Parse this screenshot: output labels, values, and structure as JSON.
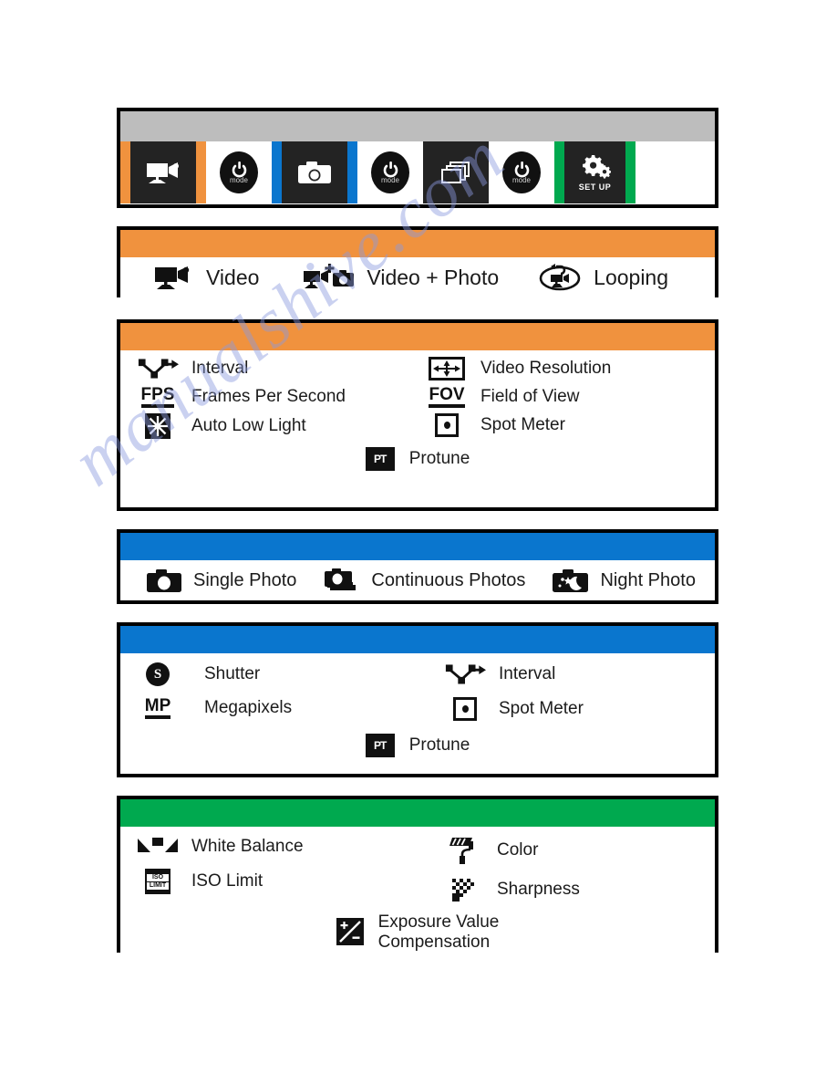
{
  "watermark": {
    "text": "manualshive.com"
  },
  "mode_strip": {
    "items": [
      {
        "name": "video-mode",
        "icon": "video-camera-icon",
        "accent": "#f0923e",
        "style": "dark"
      },
      {
        "name": "mode-button-1",
        "icon": "power-mode-icon",
        "label": "mode",
        "style": "light"
      },
      {
        "name": "photo-mode",
        "icon": "camera-icon",
        "accent": "#0a76ce",
        "style": "dark"
      },
      {
        "name": "mode-button-2",
        "icon": "power-mode-icon",
        "label": "mode",
        "style": "light"
      },
      {
        "name": "multishot-mode",
        "icon": "burst-stack-icon",
        "style": "dark"
      },
      {
        "name": "mode-button-3",
        "icon": "power-mode-icon",
        "label": "mode",
        "style": "light"
      },
      {
        "name": "setup-mode",
        "icon": "gears-icon",
        "label": "SET UP",
        "accent": "#00a94f",
        "style": "dark"
      }
    ],
    "mode_word": "mode",
    "setup_word": "SET UP"
  },
  "video_modes": {
    "accent": "#f0923e",
    "items": [
      {
        "icon": "video-camera-icon",
        "label": "Video"
      },
      {
        "icon": "video-plus-photo-icon",
        "label": "Video + Photo"
      },
      {
        "icon": "looping-icon",
        "label": "Looping"
      }
    ]
  },
  "video_settings": {
    "accent": "#f0923e",
    "left": [
      {
        "icon": "interval-icon",
        "label": "Interval"
      },
      {
        "icon": "fps-icon",
        "icon_text": "FPS",
        "label": "Frames Per Second"
      },
      {
        "icon": "auto-low-light-icon",
        "label": "Auto Low Light"
      }
    ],
    "right": [
      {
        "icon": "video-resolution-icon",
        "label": "Video Resolution"
      },
      {
        "icon": "fov-icon",
        "icon_text": "FOV",
        "label": "Field of View"
      },
      {
        "icon": "spot-meter-icon",
        "label": "Spot Meter"
      }
    ],
    "center": {
      "icon": "protune-icon",
      "icon_text": "PT",
      "label": "Protune"
    }
  },
  "photo_modes": {
    "accent": "#0a76ce",
    "items": [
      {
        "icon": "single-photo-icon",
        "label": "Single Photo"
      },
      {
        "icon": "continuous-photos-icon",
        "label": "Continuous Photos"
      },
      {
        "icon": "night-photo-icon",
        "label": "Night Photo"
      }
    ]
  },
  "photo_settings": {
    "accent": "#0a76ce",
    "left": [
      {
        "icon": "shutter-icon",
        "icon_text": "S",
        "label": "Shutter"
      },
      {
        "icon": "megapixels-icon",
        "icon_text": "MP",
        "label": "Megapixels"
      }
    ],
    "right": [
      {
        "icon": "interval-icon",
        "label": "Interval"
      },
      {
        "icon": "spot-meter-icon",
        "label": "Spot Meter"
      }
    ],
    "center": {
      "icon": "protune-icon",
      "icon_text": "PT",
      "label": "Protune"
    }
  },
  "setup_settings": {
    "accent": "#00a94f",
    "left": [
      {
        "icon": "white-balance-icon",
        "label": "White Balance"
      },
      {
        "icon": "iso-limit-icon",
        "icon_text_top": "ISO",
        "icon_text_bottom": "LIMIT",
        "label": "ISO Limit"
      }
    ],
    "right": [
      {
        "icon": "color-roller-icon",
        "label": "Color"
      },
      {
        "icon": "sharpness-icon",
        "label": "Sharpness"
      }
    ],
    "center": {
      "icon": "exposure-value-icon",
      "label_line1": "Exposure Value",
      "label_line2": "Compensation"
    }
  }
}
